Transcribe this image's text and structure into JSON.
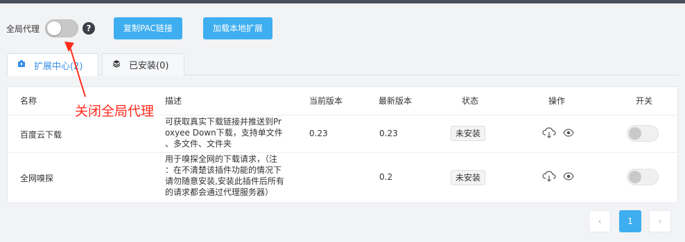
{
  "toolbar": {
    "global_proxy_label": "全局代理",
    "global_proxy_on": false,
    "help_glyph": "?",
    "copy_pac_button": "复制PAC链接",
    "load_local_button": "加载本地扩展"
  },
  "tabs": [
    {
      "label": "扩展中心(2)",
      "active": true,
      "icon": "puzzle-icon"
    },
    {
      "label": "已安装(0)",
      "active": false,
      "icon": "layers-icon"
    }
  ],
  "table": {
    "headers": {
      "name": "名称",
      "desc": "描述",
      "current_version": "当前版本",
      "latest_version": "最新版本",
      "status": "状态",
      "actions": "操作",
      "switch": "开关"
    },
    "rows": [
      {
        "name": "百度云下载",
        "desc_lines": [
          "可获取真实下载链接并推送到Pr",
          "oxyee Down下载，支持单文件",
          "、多文件、文件夹"
        ],
        "current_version": "0.23",
        "latest_version": "0.23",
        "status": "未安装",
        "enabled": false
      },
      {
        "name": "全网嗅探",
        "desc_lines": [
          "用于嗅探全网的下载请求，（注",
          "：在不清楚该插件功能的情况下",
          "请勿随意安装,安装此插件后所有",
          "的请求都会通过代理服务器）"
        ],
        "current_version": "",
        "latest_version": "0.2",
        "status": "未安装",
        "enabled": false
      }
    ]
  },
  "pagination": {
    "prev": "‹",
    "current_page": "1",
    "next": "›"
  },
  "annotation": {
    "text": "关闭全局代理",
    "color": "#ff2a1a"
  },
  "colors": {
    "accent": "#3eaef0",
    "active_tab": "#3a8ee6"
  }
}
